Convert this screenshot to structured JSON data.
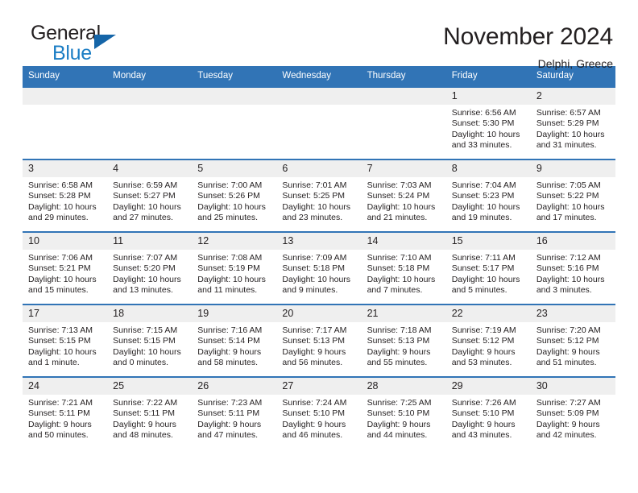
{
  "brand": {
    "name_part1": "General",
    "name_part2": "Blue",
    "triangle_color": "#1565a8",
    "blue_color": "#1a7dc4"
  },
  "header": {
    "month_title": "November 2024",
    "location": "Delphi, Greece",
    "header_bg": "#3174b6",
    "header_text": "#ffffff",
    "daynum_band_bg": "#efefef"
  },
  "weekday_headers": [
    "Sunday",
    "Monday",
    "Tuesday",
    "Wednesday",
    "Thursday",
    "Friday",
    "Saturday"
  ],
  "weeks": [
    [
      {
        "day": "",
        "empty": true
      },
      {
        "day": "",
        "empty": true
      },
      {
        "day": "",
        "empty": true
      },
      {
        "day": "",
        "empty": true
      },
      {
        "day": "",
        "empty": true
      },
      {
        "day": "1",
        "sunrise": "Sunrise: 6:56 AM",
        "sunset": "Sunset: 5:30 PM",
        "daylight": "Daylight: 10 hours and 33 minutes."
      },
      {
        "day": "2",
        "sunrise": "Sunrise: 6:57 AM",
        "sunset": "Sunset: 5:29 PM",
        "daylight": "Daylight: 10 hours and 31 minutes."
      }
    ],
    [
      {
        "day": "3",
        "sunrise": "Sunrise: 6:58 AM",
        "sunset": "Sunset: 5:28 PM",
        "daylight": "Daylight: 10 hours and 29 minutes."
      },
      {
        "day": "4",
        "sunrise": "Sunrise: 6:59 AM",
        "sunset": "Sunset: 5:27 PM",
        "daylight": "Daylight: 10 hours and 27 minutes."
      },
      {
        "day": "5",
        "sunrise": "Sunrise: 7:00 AM",
        "sunset": "Sunset: 5:26 PM",
        "daylight": "Daylight: 10 hours and 25 minutes."
      },
      {
        "day": "6",
        "sunrise": "Sunrise: 7:01 AM",
        "sunset": "Sunset: 5:25 PM",
        "daylight": "Daylight: 10 hours and 23 minutes."
      },
      {
        "day": "7",
        "sunrise": "Sunrise: 7:03 AM",
        "sunset": "Sunset: 5:24 PM",
        "daylight": "Daylight: 10 hours and 21 minutes."
      },
      {
        "day": "8",
        "sunrise": "Sunrise: 7:04 AM",
        "sunset": "Sunset: 5:23 PM",
        "daylight": "Daylight: 10 hours and 19 minutes."
      },
      {
        "day": "9",
        "sunrise": "Sunrise: 7:05 AM",
        "sunset": "Sunset: 5:22 PM",
        "daylight": "Daylight: 10 hours and 17 minutes."
      }
    ],
    [
      {
        "day": "10",
        "sunrise": "Sunrise: 7:06 AM",
        "sunset": "Sunset: 5:21 PM",
        "daylight": "Daylight: 10 hours and 15 minutes."
      },
      {
        "day": "11",
        "sunrise": "Sunrise: 7:07 AM",
        "sunset": "Sunset: 5:20 PM",
        "daylight": "Daylight: 10 hours and 13 minutes."
      },
      {
        "day": "12",
        "sunrise": "Sunrise: 7:08 AM",
        "sunset": "Sunset: 5:19 PM",
        "daylight": "Daylight: 10 hours and 11 minutes."
      },
      {
        "day": "13",
        "sunrise": "Sunrise: 7:09 AM",
        "sunset": "Sunset: 5:18 PM",
        "daylight": "Daylight: 10 hours and 9 minutes."
      },
      {
        "day": "14",
        "sunrise": "Sunrise: 7:10 AM",
        "sunset": "Sunset: 5:18 PM",
        "daylight": "Daylight: 10 hours and 7 minutes."
      },
      {
        "day": "15",
        "sunrise": "Sunrise: 7:11 AM",
        "sunset": "Sunset: 5:17 PM",
        "daylight": "Daylight: 10 hours and 5 minutes."
      },
      {
        "day": "16",
        "sunrise": "Sunrise: 7:12 AM",
        "sunset": "Sunset: 5:16 PM",
        "daylight": "Daylight: 10 hours and 3 minutes."
      }
    ],
    [
      {
        "day": "17",
        "sunrise": "Sunrise: 7:13 AM",
        "sunset": "Sunset: 5:15 PM",
        "daylight": "Daylight: 10 hours and 1 minute."
      },
      {
        "day": "18",
        "sunrise": "Sunrise: 7:15 AM",
        "sunset": "Sunset: 5:15 PM",
        "daylight": "Daylight: 10 hours and 0 minutes."
      },
      {
        "day": "19",
        "sunrise": "Sunrise: 7:16 AM",
        "sunset": "Sunset: 5:14 PM",
        "daylight": "Daylight: 9 hours and 58 minutes."
      },
      {
        "day": "20",
        "sunrise": "Sunrise: 7:17 AM",
        "sunset": "Sunset: 5:13 PM",
        "daylight": "Daylight: 9 hours and 56 minutes."
      },
      {
        "day": "21",
        "sunrise": "Sunrise: 7:18 AM",
        "sunset": "Sunset: 5:13 PM",
        "daylight": "Daylight: 9 hours and 55 minutes."
      },
      {
        "day": "22",
        "sunrise": "Sunrise: 7:19 AM",
        "sunset": "Sunset: 5:12 PM",
        "daylight": "Daylight: 9 hours and 53 minutes."
      },
      {
        "day": "23",
        "sunrise": "Sunrise: 7:20 AM",
        "sunset": "Sunset: 5:12 PM",
        "daylight": "Daylight: 9 hours and 51 minutes."
      }
    ],
    [
      {
        "day": "24",
        "sunrise": "Sunrise: 7:21 AM",
        "sunset": "Sunset: 5:11 PM",
        "daylight": "Daylight: 9 hours and 50 minutes."
      },
      {
        "day": "25",
        "sunrise": "Sunrise: 7:22 AM",
        "sunset": "Sunset: 5:11 PM",
        "daylight": "Daylight: 9 hours and 48 minutes."
      },
      {
        "day": "26",
        "sunrise": "Sunrise: 7:23 AM",
        "sunset": "Sunset: 5:11 PM",
        "daylight": "Daylight: 9 hours and 47 minutes."
      },
      {
        "day": "27",
        "sunrise": "Sunrise: 7:24 AM",
        "sunset": "Sunset: 5:10 PM",
        "daylight": "Daylight: 9 hours and 46 minutes."
      },
      {
        "day": "28",
        "sunrise": "Sunrise: 7:25 AM",
        "sunset": "Sunset: 5:10 PM",
        "daylight": "Daylight: 9 hours and 44 minutes."
      },
      {
        "day": "29",
        "sunrise": "Sunrise: 7:26 AM",
        "sunset": "Sunset: 5:10 PM",
        "daylight": "Daylight: 9 hours and 43 minutes."
      },
      {
        "day": "30",
        "sunrise": "Sunrise: 7:27 AM",
        "sunset": "Sunset: 5:09 PM",
        "daylight": "Daylight: 9 hours and 42 minutes."
      }
    ]
  ]
}
